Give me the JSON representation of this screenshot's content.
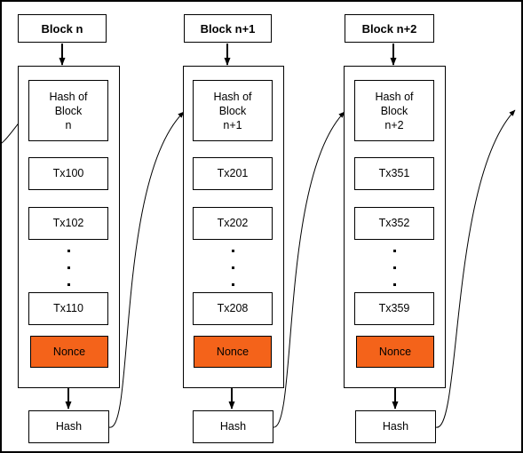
{
  "diagram": {
    "title": "Blockchain block chaining diagram",
    "colors": {
      "nonce_fill": "#F4631A",
      "stroke": "#000000",
      "background": "#ffffff"
    },
    "ellipsis_symbol": "·",
    "blocks": [
      {
        "header_label": "Block n",
        "hash_of_block": "Hash of\nBlock\nn",
        "hash_of_block_lines": [
          "Hash of",
          "Block",
          "n"
        ],
        "transactions": [
          "Tx100",
          "Tx102"
        ],
        "transactions_tail": "Tx110",
        "nonce_label": "Nonce",
        "hash_label": "Hash"
      },
      {
        "header_label": "Block n+1",
        "hash_of_block": "Hash of\nBlock\nn+1",
        "hash_of_block_lines": [
          "Hash of",
          "Block",
          "n+1"
        ],
        "transactions": [
          "Tx201",
          "Tx202"
        ],
        "transactions_tail": "Tx208",
        "nonce_label": "Nonce",
        "hash_label": "Hash"
      },
      {
        "header_label": "Block n+2",
        "hash_of_block": "Hash of\nBlock\nn+2",
        "hash_of_block_lines": [
          "Hash of",
          "Block",
          "n+2"
        ],
        "transactions": [
          "Tx351",
          "Tx352"
        ],
        "transactions_tail": "Tx359",
        "nonce_label": "Nonce",
        "hash_label": "Hash"
      }
    ]
  }
}
